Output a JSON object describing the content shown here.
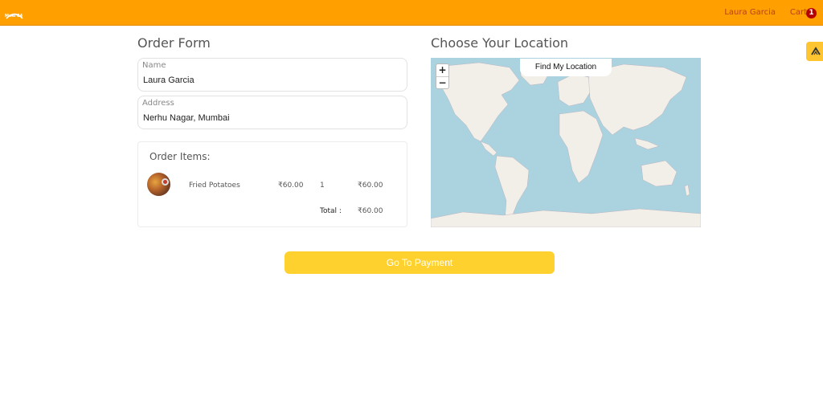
{
  "navbar": {
    "logo_text": "Meal 24",
    "user_name": "Laura Garcia",
    "cart_label": "Cart",
    "cart_count": "1"
  },
  "order_form": {
    "title": "Order Form",
    "name_label": "Name",
    "name_value": "Laura Garcia",
    "address_label": "Address",
    "address_value": "Nerhu Nagar, Mumbai"
  },
  "order_items": {
    "title": "Order Items:",
    "items": [
      {
        "name": "Fried Potatoes",
        "price": "₹60.00",
        "quantity": "1",
        "subtotal": "₹60.00"
      }
    ],
    "total_label": "Total :",
    "total_value": "₹60.00"
  },
  "location": {
    "title": "Choose Your Location",
    "find_button": "Find My Location",
    "zoom_in": "+",
    "zoom_out": "−"
  },
  "payment_button": "Go To Payment",
  "icons": {
    "logo": "food-delivery-logo",
    "side_widget": "arrow-up-icon"
  },
  "colors": {
    "navbar": "#ff9f00",
    "nav_text": "#b8401c",
    "badge": "#b40000",
    "payment_button": "#ffd12e",
    "water": "#aad3df",
    "land": "#f2efe9"
  }
}
